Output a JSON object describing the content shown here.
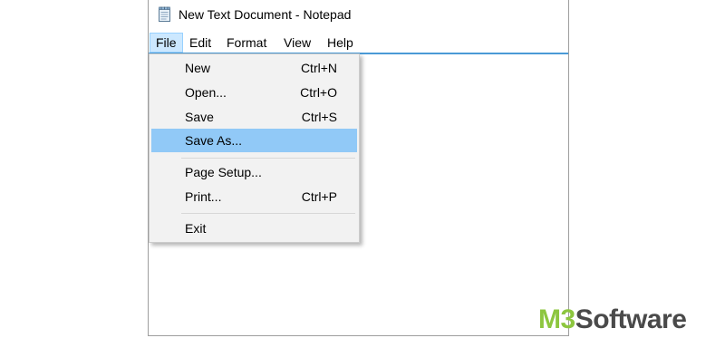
{
  "window": {
    "title": "New Text Document - Notepad",
    "icon": "notepad-icon"
  },
  "menubar": {
    "items": [
      {
        "label": "File"
      },
      {
        "label": "Edit"
      },
      {
        "label": "Format"
      },
      {
        "label": "View"
      },
      {
        "label": "Help"
      }
    ],
    "active": "File"
  },
  "file_menu": {
    "items": [
      {
        "label": "New",
        "shortcut": "Ctrl+N"
      },
      {
        "label": "Open...",
        "shortcut": "Ctrl+O"
      },
      {
        "label": "Save",
        "shortcut": "Ctrl+S"
      },
      {
        "label": "Save As...",
        "shortcut": ""
      },
      {
        "label": "Page Setup...",
        "shortcut": ""
      },
      {
        "label": "Print...",
        "shortcut": "Ctrl+P"
      },
      {
        "label": "Exit",
        "shortcut": ""
      }
    ],
    "highlighted": "Save As..."
  },
  "watermark": {
    "brand": "M3",
    "word": "Software",
    "brand_color": "#8dc63f",
    "word_color": "#4a4a4a"
  },
  "colors": {
    "menu_highlight": "#91c9f7",
    "menubar_active": "#cce8ff",
    "menubar_underline": "#4a9ad6"
  }
}
